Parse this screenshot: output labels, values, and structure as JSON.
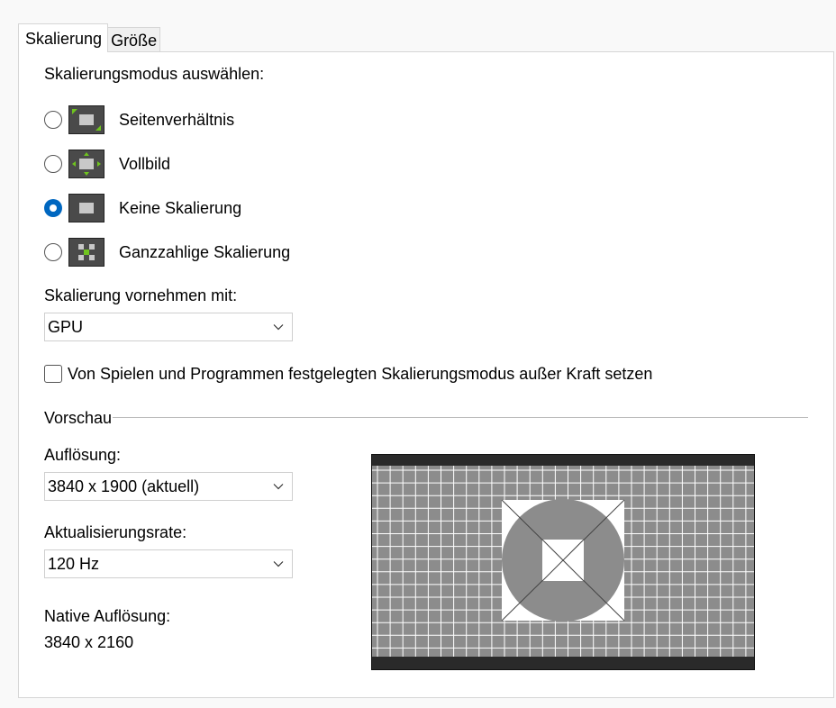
{
  "tabs": [
    {
      "label": "Skalierung",
      "active": true
    },
    {
      "label": "Größe",
      "active": false
    }
  ],
  "scaling_mode": {
    "heading": "Skalierungsmodus auswählen:",
    "options": [
      {
        "label": "Seitenverhältnis",
        "icon": "aspect-ratio-icon",
        "checked": false
      },
      {
        "label": "Vollbild",
        "icon": "fullscreen-icon",
        "checked": false
      },
      {
        "label": "Keine Skalierung",
        "icon": "no-scaling-icon",
        "checked": true
      },
      {
        "label": "Ganzzahlige Skalierung",
        "icon": "integer-scaling-icon",
        "checked": false
      }
    ]
  },
  "perform_scaling": {
    "label": "Skalierung vornehmen mit:",
    "value": "GPU"
  },
  "override": {
    "label": "Von Spielen und Programmen festgelegten Skalierungsmodus außer Kraft setzen",
    "checked": false
  },
  "preview": {
    "group_label": "Vorschau",
    "resolution_label": "Auflösung:",
    "resolution_value": "3840 x 1900 (aktuell)",
    "refresh_label": "Aktualisierungsrate:",
    "refresh_value": "120 Hz",
    "native_label": "Native Auflösung:",
    "native_value": "3840 x 2160"
  },
  "colors": {
    "accent": "#0067c0",
    "icon_green": "#6fc41e",
    "preview_gray": "#8c8c8c"
  }
}
